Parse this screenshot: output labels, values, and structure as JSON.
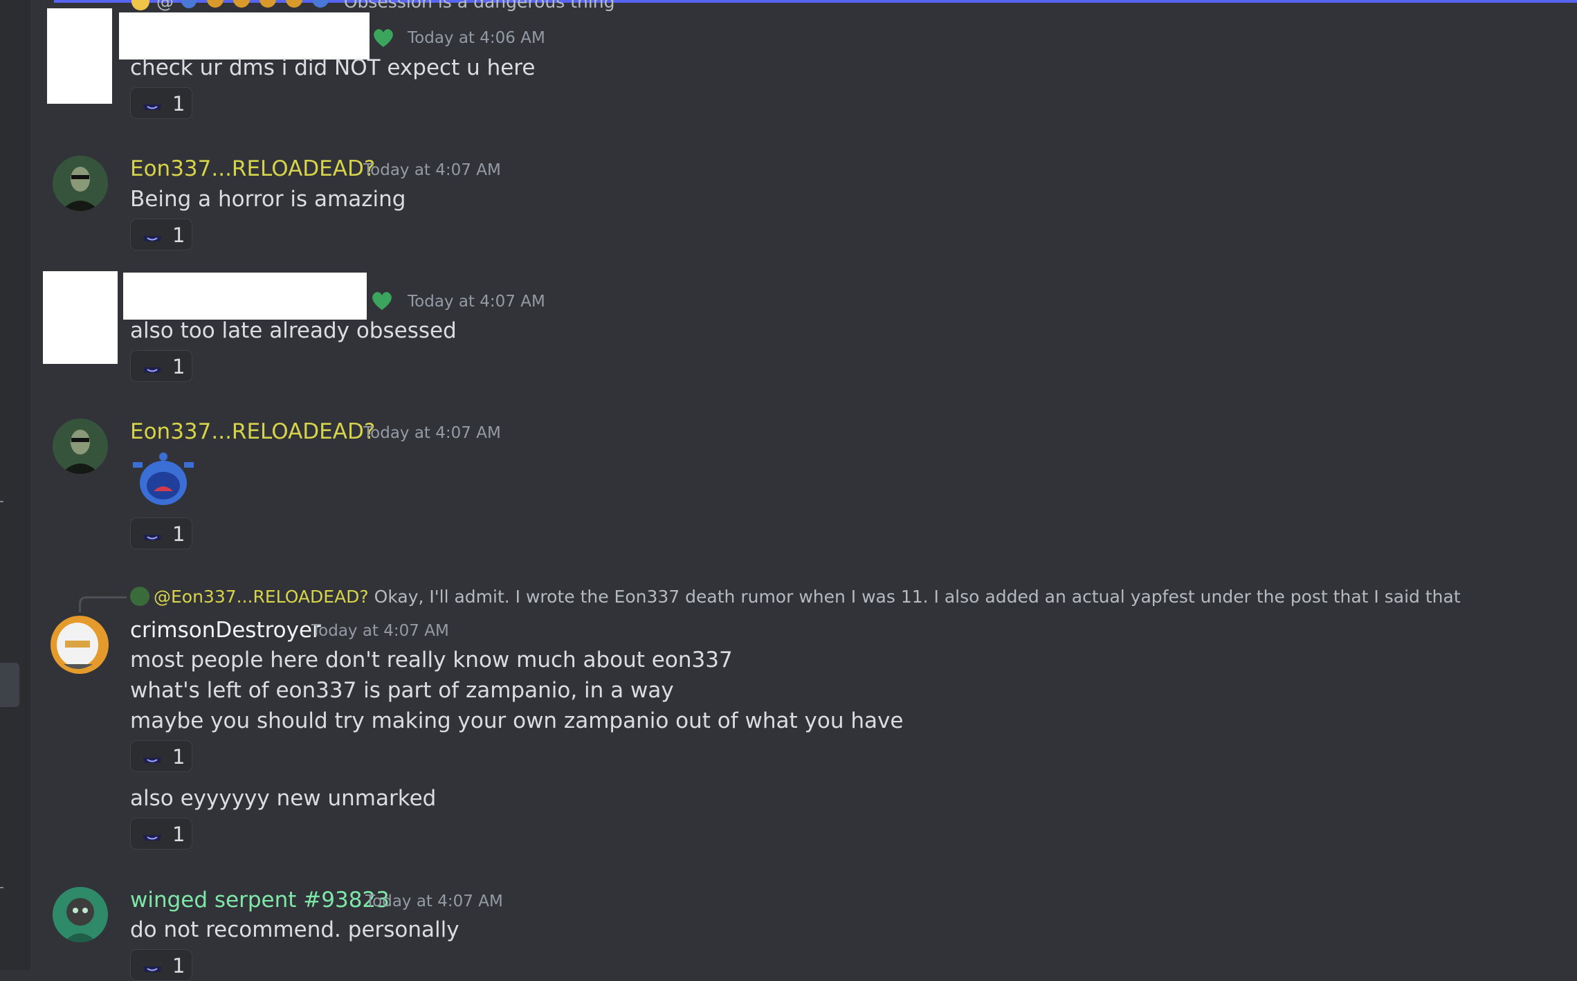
{
  "top_reply": {
    "prefix": "@",
    "preview": "Obsession is a dangerous thing"
  },
  "messages": [
    {
      "author": "",
      "author_redacted": true,
      "badge_icon": "green-heart-badge-icon",
      "timestamp": "Today at 4:06 AM",
      "lines": [
        "check ur dms i did NOT expect u here"
      ],
      "reactions": [
        {
          "icon": "hat-emoji-icon",
          "count": "1"
        }
      ]
    },
    {
      "author": "Eon337...RELOADEAD?",
      "author_color": "#d7d34a",
      "timestamp": "Today at 4:07 AM",
      "lines": [
        "Being a horror is amazing"
      ],
      "reactions": [
        {
          "icon": "hat-emoji-icon",
          "count": "1"
        }
      ]
    },
    {
      "author": "",
      "author_redacted": true,
      "badge_icon": "green-heart-badge-icon",
      "timestamp": "Today at 4:07 AM",
      "lines": [
        "also too late already obsessed"
      ],
      "reactions": [
        {
          "icon": "hat-emoji-icon",
          "count": "1"
        }
      ]
    },
    {
      "author": "Eon337...RELOADEAD?",
      "author_color": "#d7d34a",
      "timestamp": "Today at 4:07 AM",
      "sticker_icon": "crying-blue-face-emoji-icon",
      "reactions": [
        {
          "icon": "hat-emoji-icon",
          "count": "1"
        }
      ]
    },
    {
      "reply_to": {
        "mention": "@Eon337...RELOADEAD?",
        "text": "Okay, I'll admit. I wrote the Eon337 death rumor when I was 11. I also added an actual yapfest under the post that I said that"
      },
      "author": "crimsonDestroyer",
      "author_color": "#f2f3f5",
      "timestamp": "Today at 4:07 AM",
      "lines": [
        "most people here don't really know much about eon337",
        "what's left of eon337 is part of zampanio, in a way",
        "maybe you should try making your own zampanio out of what you have"
      ],
      "reactions": [
        {
          "icon": "hat-emoji-icon",
          "count": "1"
        }
      ],
      "followup": {
        "text": "also eyyyyyy new unmarked",
        "reactions": [
          {
            "icon": "hat-emoji-icon",
            "count": "1"
          }
        ]
      }
    },
    {
      "author": "winged serpent #93823",
      "author_color": "#7ee8a8",
      "timestamp": "Today at 4:07 AM",
      "lines": [
        "do not recommend. personally"
      ],
      "reactions": [
        {
          "icon": "hat-emoji-icon",
          "count": "1"
        }
      ]
    }
  ]
}
